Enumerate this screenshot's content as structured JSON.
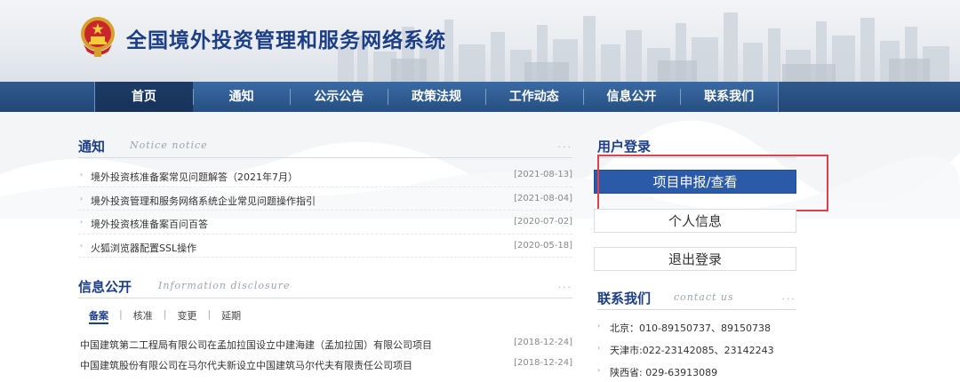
{
  "header": {
    "site_title": "全国境外投资管理和服务网络系统"
  },
  "nav": {
    "items": [
      {
        "label": "首页",
        "active": true
      },
      {
        "label": "通知"
      },
      {
        "label": "公示公告"
      },
      {
        "label": "政策法规"
      },
      {
        "label": "工作动态"
      },
      {
        "label": "信息公开"
      },
      {
        "label": "联系我们"
      }
    ]
  },
  "notice": {
    "title": "通知",
    "subtitle": "Notice notice",
    "more": "...",
    "items": [
      {
        "text": "境外投资核准备案常见问题解答（2021年7月）",
        "date": "[2021-08-13]"
      },
      {
        "text": "境外投资管理和服务网络系统企业常见问题操作指引",
        "date": "[2021-08-04]"
      },
      {
        "text": "境外投资核准备案百问百答",
        "date": "[2020-07-02]"
      },
      {
        "text": "火狐浏览器配置SSL操作",
        "date": "[2020-05-18]"
      }
    ]
  },
  "disclosure": {
    "title": "信息公开",
    "subtitle": "Information disclosure",
    "more": "...",
    "tabs": [
      "备案",
      "核准",
      "变更",
      "延期"
    ],
    "items": [
      {
        "text": "中国建筑第二工程局有限公司在孟加拉国设立中建海建（孟加拉国）有限公司项目",
        "date": "[2018-12-24]"
      },
      {
        "text": "中国建筑股份有限公司在马尔代夫新设立中国建筑马尔代夫有限责任公司项目",
        "date": "[2018-12-24]"
      }
    ]
  },
  "user_login": {
    "title": "用户登录",
    "buttons": {
      "project": "项目申报/查看",
      "profile": "个人信息",
      "logout": "退出登录"
    }
  },
  "contact": {
    "title": "联系我们",
    "subtitle": "contact us",
    "more": "...",
    "items": [
      "北京：010-89150737、89150738",
      "天津市:022-23142085、23142243",
      "陕西省: 029-63913089"
    ]
  },
  "colors": {
    "brand_blue": "#1b3e86",
    "nav_blue": "#2c5a92",
    "primary_button": "#2a5aa8",
    "highlight_red": "#e0414a"
  }
}
